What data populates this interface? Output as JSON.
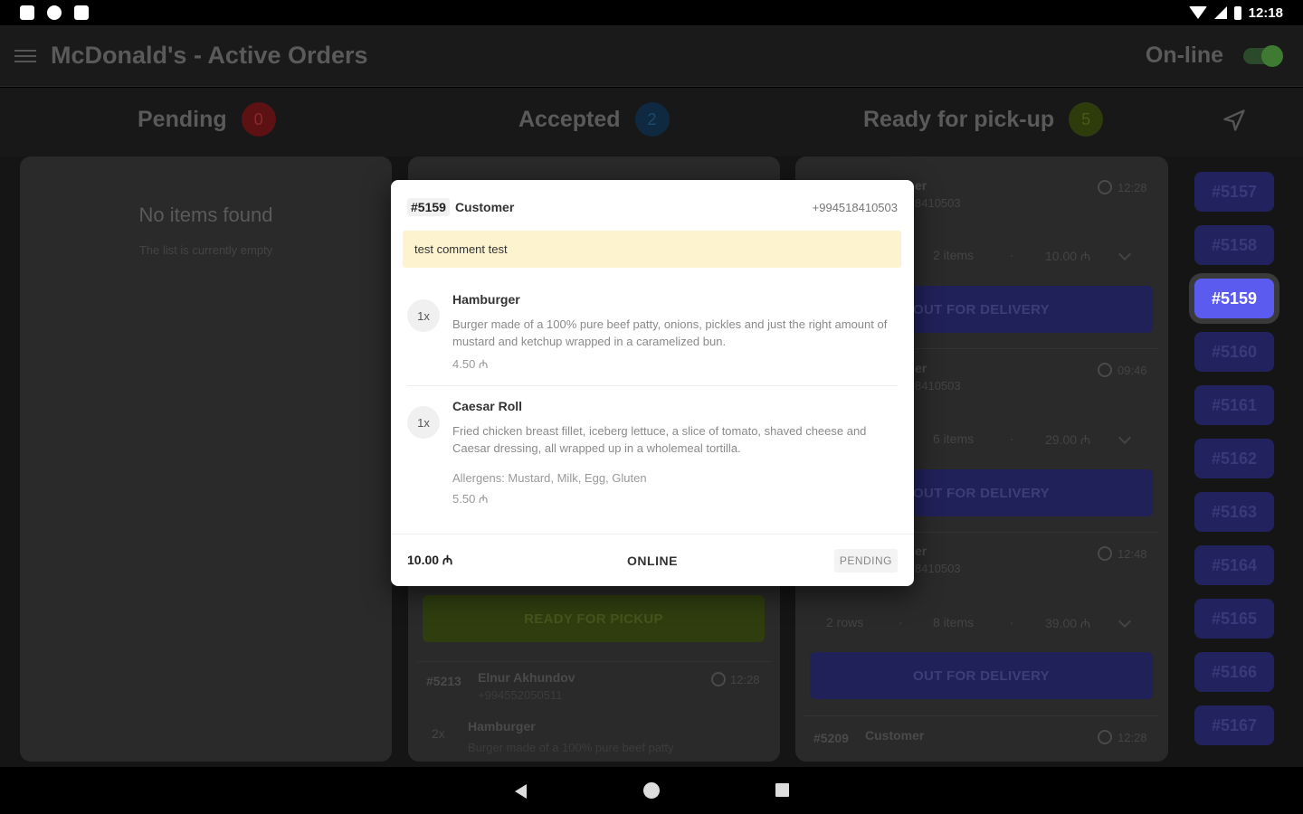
{
  "status_bar": {
    "time": "12:18"
  },
  "app": {
    "title": "McDonald's - Active Orders",
    "online_label": "On-line"
  },
  "tabs": [
    {
      "label": "Pending",
      "count": "0",
      "color": "#7a1a1a"
    },
    {
      "label": "Accepted",
      "count": "2",
      "color": "#12324a"
    },
    {
      "label": "Ready for pick-up",
      "count": "5",
      "color": "#3a4a0e"
    }
  ],
  "pending_column": {
    "empty_title": "No items found",
    "empty_sub": "The list is currently empty"
  },
  "accepted_column": {
    "ready_button": "READY FOR PICKUP",
    "card": {
      "order": "#5213",
      "customer": "Elnur Akhundov",
      "phone": "+994552050511",
      "time": "12:28",
      "item_qty": "2x",
      "item_name": "Hamburger",
      "item_desc": "Burger made of a 100% pure beef patty"
    }
  },
  "ready_column": {
    "cards": [
      {
        "customer_frag": "er",
        "phone_frag": "8410503",
        "time": "12:28",
        "items": "2 items",
        "total": "10.00 ₼",
        "button": "OUT FOR DELIVERY"
      },
      {
        "customer_frag": "er",
        "phone_frag": "8410503",
        "time": "09:46",
        "items": "6 items",
        "total": "29.00 ₼",
        "button": "OUT FOR DELIVERY"
      },
      {
        "customer_frag": "er",
        "phone_frag": "8410503",
        "time": "12:48",
        "rows": "2 rows",
        "items": "8 items",
        "total": "39.00 ₼",
        "button": "OUT FOR DELIVERY"
      }
    ],
    "last_card": {
      "order": "#5209",
      "customer": "Customer",
      "time": "12:28"
    }
  },
  "order_chips": [
    "#5157",
    "#5158",
    "#5159",
    "#5160",
    "#5161",
    "#5162",
    "#5163",
    "#5164",
    "#5165",
    "#5166",
    "#5167"
  ],
  "active_chip": "#5159",
  "modal": {
    "order": "#5159",
    "customer": "Customer",
    "phone": "+994518410503",
    "comment": "test comment test",
    "items": [
      {
        "qty": "1x",
        "name": "Hamburger",
        "desc": "Burger made of a 100% pure beef patty, onions, pickles and just the right amount of mustard and ketchup wrapped in a caramelized bun.",
        "price": "4.50 ₼"
      },
      {
        "qty": "1x",
        "name": "Caesar Roll",
        "desc": "Fried chicken breast fillet, iceberg lettuce, a slice of tomato, shaved cheese and Caesar dressing, all wrapped up in a wholemeal tortilla.",
        "allergens": "Allergens: Mustard, Milk, Egg, Gluten",
        "price": "5.50 ₼"
      }
    ],
    "total": "10.00 ₼",
    "payment": "ONLINE",
    "status": "PENDING"
  }
}
